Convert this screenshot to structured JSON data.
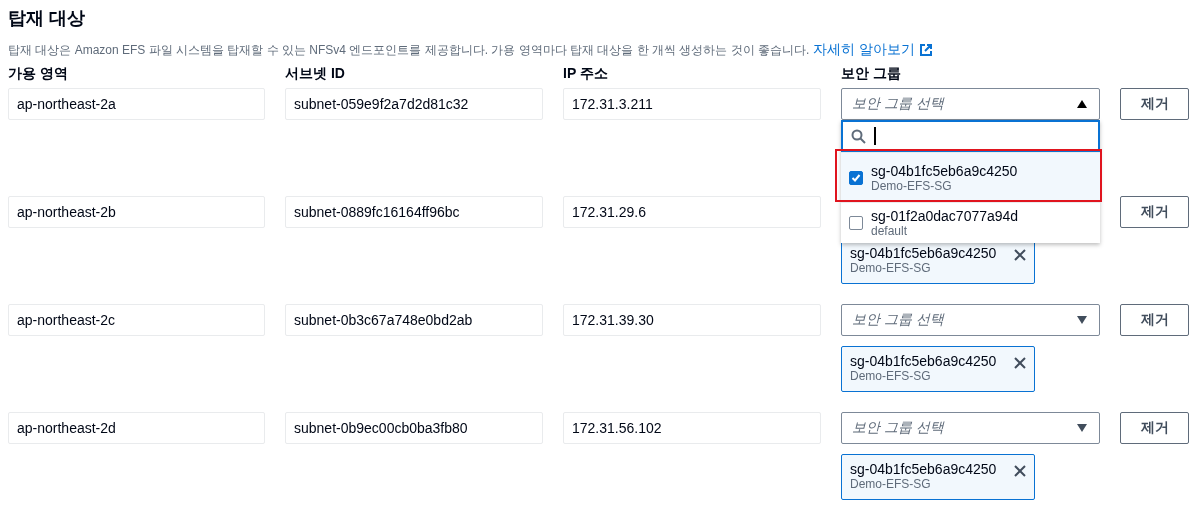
{
  "section": {
    "title": "탑재 대상",
    "description": "탑재 대상은 Amazon EFS 파일 시스템을 탑재할 수 있는 NFSv4 엔드포인트를 제공합니다. 가용 영역마다 탑재 대상을 한 개씩 생성하는 것이 좋습니다.",
    "link": "자세히 알아보기"
  },
  "columns": [
    "가용 영역",
    "서브넷 ID",
    "IP 주소",
    "보안 그룹"
  ],
  "rows": [
    {
      "zone": "ap-northeast-2a",
      "subnet": "subnet-059e9f2a7d2d81c32",
      "ip": "172.31.3.211",
      "select": {
        "placeholder": "보안 그룹 선택",
        "expanded": true,
        "options": [
          {
            "id": "sg-04b1fc5eb6a9c4250",
            "name": "Demo-EFS-SG",
            "checked": true,
            "highlighted": true
          },
          {
            "id": "sg-01f2a0dac7077a94d",
            "name": "default",
            "checked": false,
            "highlighted": false
          }
        ]
      },
      "tokens": [],
      "remove": "제거"
    },
    {
      "zone": "ap-northeast-2b",
      "subnet": "subnet-0889fc16164ff96bc",
      "ip": "172.31.29.6",
      "tokens": [
        {
          "id": "sg-04b1fc5eb6a9c4250",
          "name": "Demo-EFS-SG"
        }
      ],
      "remove": "제거"
    },
    {
      "zone": "ap-northeast-2c",
      "subnet": "subnet-0b3c67a748e0bd2ab",
      "ip": "172.31.39.30",
      "select": {
        "placeholder": "보안 그룹 선택",
        "expanded": false
      },
      "tokens": [
        {
          "id": "sg-04b1fc5eb6a9c4250",
          "name": "Demo-EFS-SG"
        }
      ],
      "remove": "제거"
    },
    {
      "zone": "ap-northeast-2d",
      "subnet": "subnet-0b9ec00cb0ba3fb80",
      "ip": "172.31.56.102",
      "select": {
        "placeholder": "보안 그룹 선택",
        "expanded": false
      },
      "tokens": [
        {
          "id": "sg-04b1fc5eb6a9c4250",
          "name": "Demo-EFS-SG"
        }
      ],
      "remove": "제거"
    }
  ]
}
